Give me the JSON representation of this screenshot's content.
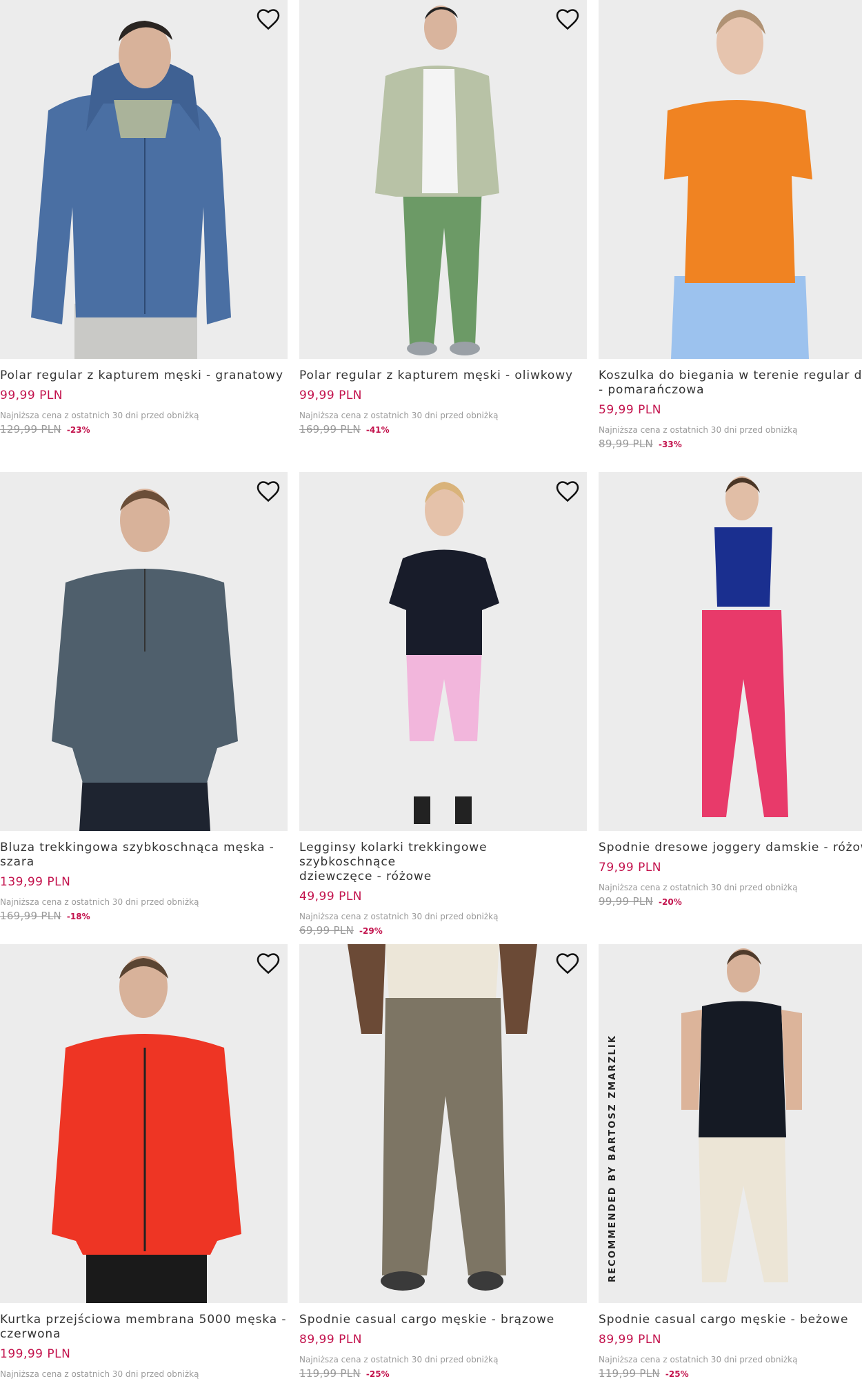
{
  "products": [
    {
      "title": "Polar regular z kapturem męski - granatowy",
      "price": "99,99 PLN",
      "lowest_note": "Najniższa cena z ostatnich 30 dni przed obniżką",
      "old_price": "129,99 PLN",
      "discount": "-23%",
      "favorite_icon": "heart-icon"
    },
    {
      "title": "Polar regular z kapturem męski - oliwkowy",
      "price": "99,99 PLN",
      "lowest_note": "Najniższa cena z ostatnich 30 dni przed obniżką",
      "old_price": "169,99 PLN",
      "discount": "-41%",
      "favorite_icon": "heart-icon"
    },
    {
      "title": "Koszulka do biegania w terenie regular dam\n- pomarańczowa",
      "price": "59,99 PLN",
      "lowest_note": "Najniższa cena z ostatnich 30 dni przed obniżką",
      "old_price": "89,99 PLN",
      "discount": "-33%",
      "favorite_icon": "heart-icon"
    },
    {
      "title": "Bluza trekkingowa szybkoschnąca męska -\nszara",
      "price": "139,99 PLN",
      "lowest_note": "Najniższa cena z ostatnich 30 dni przed obniżką",
      "old_price": "169,99 PLN",
      "discount": "-18%",
      "favorite_icon": "heart-icon"
    },
    {
      "title": "Legginsy kolarki trekkingowe szybkoschnące\ndziewczęce - różowe",
      "price": "49,99 PLN",
      "lowest_note": "Najniższa cena z ostatnich 30 dni przed obniżką",
      "old_price": "69,99 PLN",
      "discount": "-29%",
      "favorite_icon": "heart-icon"
    },
    {
      "title": "Spodnie dresowe joggery damskie - różowe",
      "price": "79,99 PLN",
      "lowest_note": "Najniższa cena z ostatnich 30 dni przed obniżką",
      "old_price": "99,99 PLN",
      "discount": "-20%",
      "favorite_icon": "heart-icon"
    },
    {
      "title": "Kurtka przejściowa membrana 5000 męska -\nczerwona",
      "price": "199,99 PLN",
      "lowest_note": "Najniższa cena z ostatnich 30 dni przed obniżką",
      "old_price": "",
      "discount": "",
      "favorite_icon": "heart-icon"
    },
    {
      "title": "Spodnie casual cargo męskie - brązowe",
      "price": "89,99 PLN",
      "lowest_note": "Najniższa cena z ostatnich 30 dni przed obniżką",
      "old_price": "119,99 PLN",
      "discount": "-25%",
      "favorite_icon": "heart-icon"
    },
    {
      "title": "Spodnie casual cargo męskie - beżowe",
      "price": "89,99 PLN",
      "lowest_note": "Najniższa cena z ostatnich 30 dni przed obniżką",
      "old_price": "119,99 PLN",
      "discount": "-25%",
      "favorite_icon": "heart-icon",
      "side_label": "RECOMMENDED BY BARTOSZ ZMARZLIK"
    }
  ],
  "colors": {
    "price": "#c3134d",
    "muted": "#9a9a9a",
    "image_bg": "#ececec"
  }
}
